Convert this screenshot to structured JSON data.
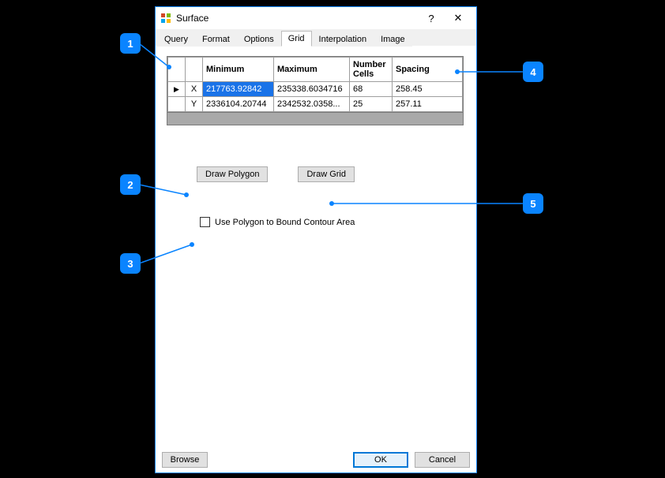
{
  "window": {
    "title": "Surface",
    "help_label": "?",
    "close_label": "✕"
  },
  "tabs": {
    "items": [
      {
        "label": "Query"
      },
      {
        "label": "Format"
      },
      {
        "label": "Options"
      },
      {
        "label": "Grid"
      },
      {
        "label": "Interpolation"
      },
      {
        "label": "Image"
      }
    ],
    "active_index": 3
  },
  "grid": {
    "headers": {
      "minimum": "Minimum",
      "maximum": "Maximum",
      "number_cells": "Number Cells",
      "spacing": "Spacing"
    },
    "row_marker": "▶",
    "rows": [
      {
        "axis": "X",
        "min": "217763.92842",
        "max": "235338.6034716",
        "cells": "68",
        "spacing": "258.45",
        "selected_min": true
      },
      {
        "axis": "Y",
        "min": "2336104.20744",
        "max": "2342532.0358...",
        "cells": "25",
        "spacing": "257.11",
        "selected_min": false
      }
    ]
  },
  "buttons": {
    "draw_polygon": "Draw Polygon",
    "draw_grid": "Draw Grid",
    "browse": "Browse",
    "ok": "OK",
    "cancel": "Cancel"
  },
  "checkbox": {
    "label": "Use Polygon to Bound Contour Area",
    "checked": false
  },
  "callouts": {
    "1": "1",
    "2": "2",
    "3": "3",
    "4": "4",
    "5": "5"
  }
}
